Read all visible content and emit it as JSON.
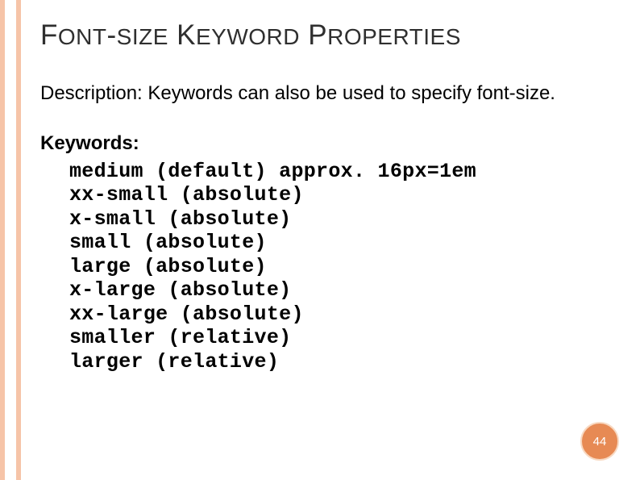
{
  "title": {
    "w1a": "F",
    "w1b": "ONT",
    "dash": "-",
    "w2a": "S",
    "w2b": "IZE",
    "sp1": " ",
    "w3a": "K",
    "w3b": "EYWORD",
    "sp2": " ",
    "w4a": "P",
    "w4b": "ROPERTIES"
  },
  "description": "Description: Keywords can also be used to specify font-size.",
  "keywords_label": "Keywords:",
  "keywords": [
    "medium (default) approx. 16px=1em",
    "xx-small (absolute)",
    "x-small (absolute)",
    "small (absolute)",
    "large (absolute)",
    "x-large (absolute)",
    "xx-large (absolute)",
    "smaller (relative)",
    "larger (relative)"
  ],
  "page_number": "44"
}
